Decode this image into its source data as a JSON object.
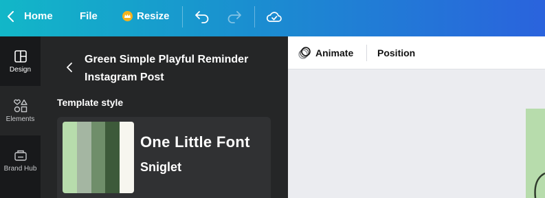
{
  "header": {
    "back_label": "Home",
    "file_label": "File",
    "resize_label": "Resize",
    "icons": [
      "chevron-left-icon",
      "crown-icon",
      "undo-icon",
      "redo-icon",
      "cloud-check-icon"
    ]
  },
  "rail": {
    "items": [
      {
        "label": "Design",
        "icon": "layout-icon"
      },
      {
        "label": "Elements",
        "icon": "shapes-icon"
      },
      {
        "label": "Brand Hub",
        "icon": "brand-kit-icon"
      }
    ]
  },
  "panel": {
    "title": "Green Simple Playful Reminder Instagram Post",
    "section_label": "Template style",
    "heading_font": "One Little Font",
    "body_font": "Sniglet",
    "palette": [
      "#b7dcac",
      "#a4b6a2",
      "#6f8e6a",
      "#3d5a3a",
      "#f7f6ef"
    ]
  },
  "toolbar": {
    "animate_label": "Animate",
    "position_label": "Position"
  },
  "colors": {
    "header_gradient_start": "#12b7c8",
    "header_gradient_end": "#2a63dd",
    "rail_bg": "#18191b",
    "panel_bg": "#252627",
    "canvas_bg": "#ebecf0",
    "page_bg": "#b7dcac"
  }
}
